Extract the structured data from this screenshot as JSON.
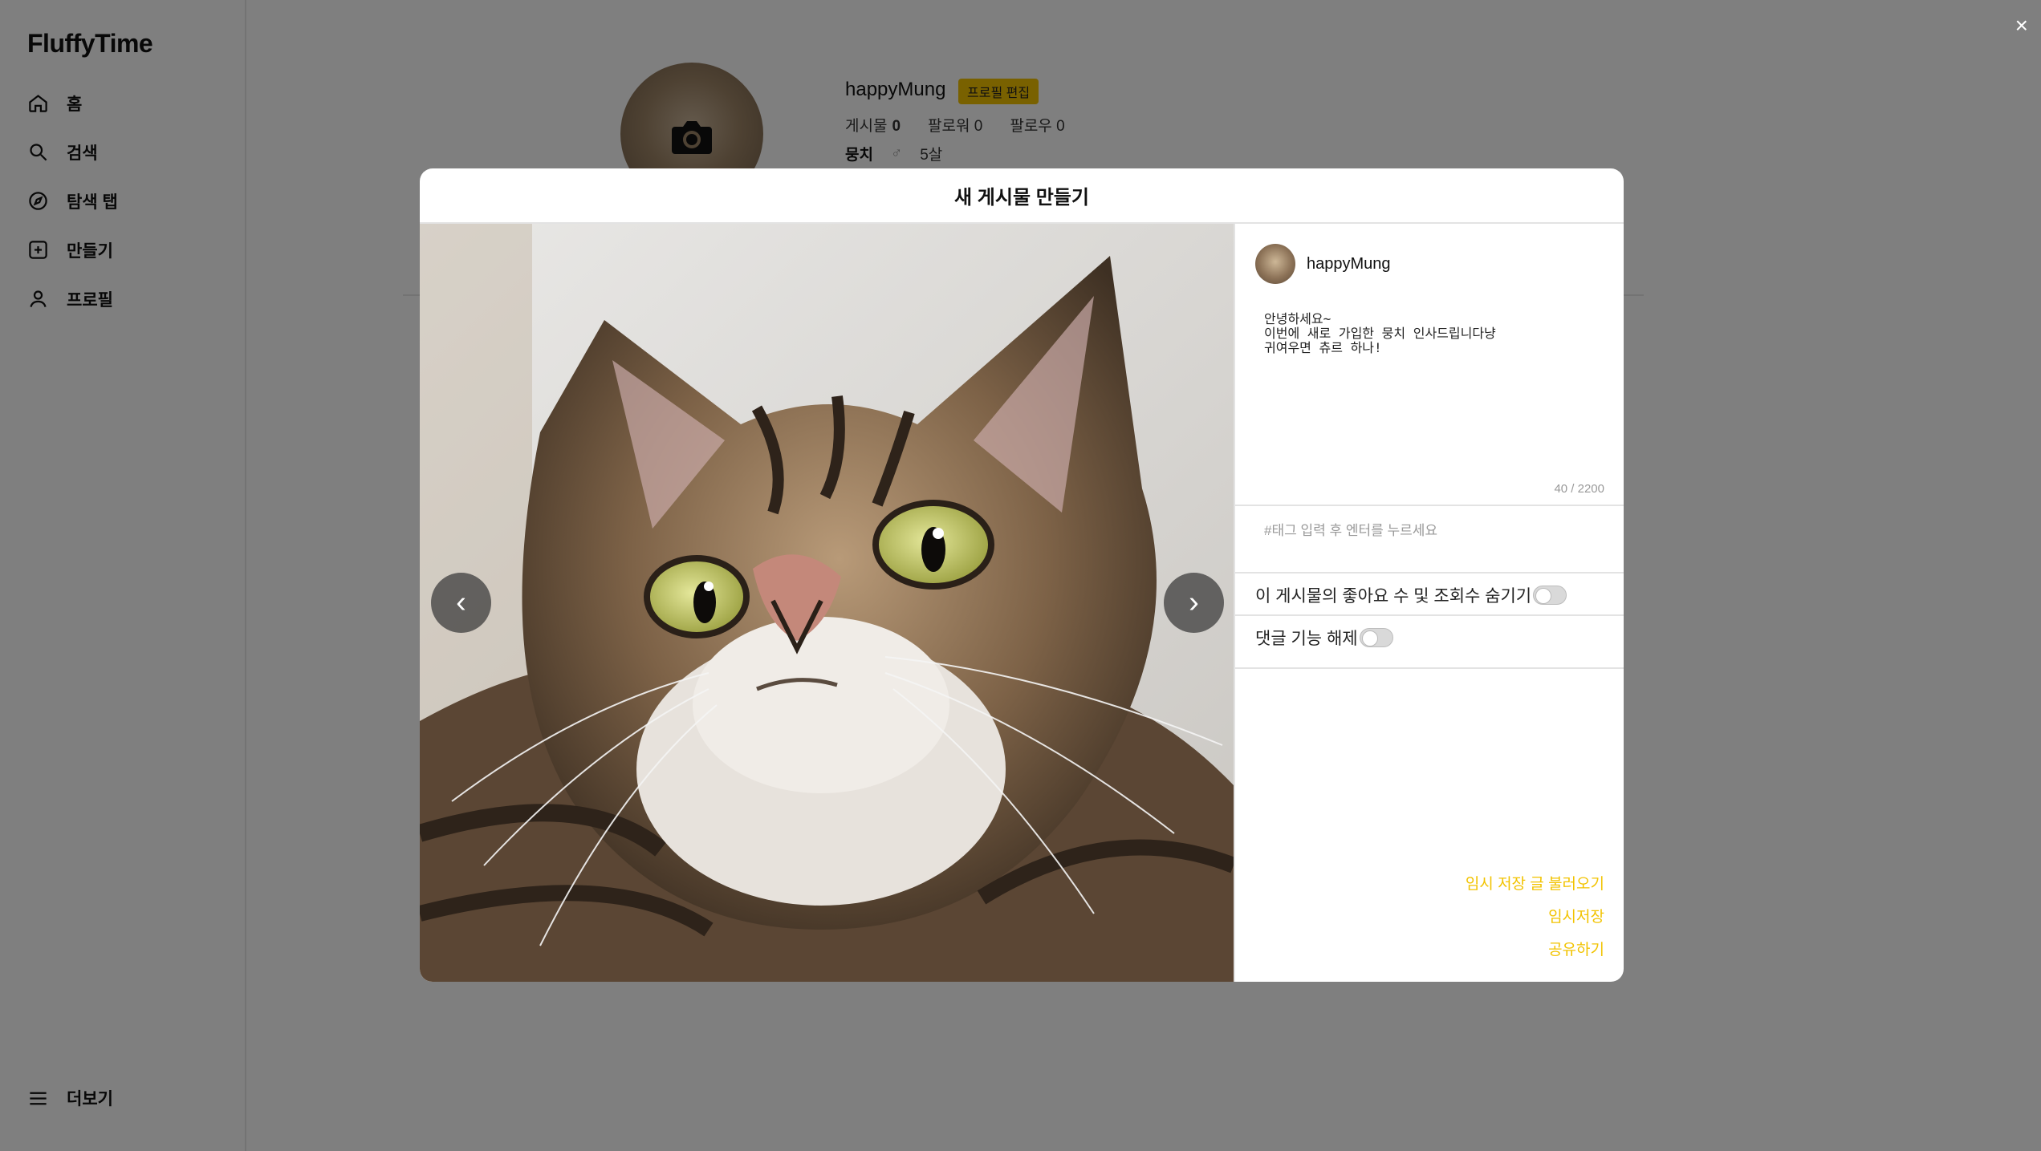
{
  "app": {
    "logo": "FluffyTime"
  },
  "sidebar": {
    "items": [
      {
        "label": "홈",
        "icon": "home-icon"
      },
      {
        "label": "검색",
        "icon": "search-icon"
      },
      {
        "label": "탐색 탭",
        "icon": "compass-icon"
      },
      {
        "label": "만들기",
        "icon": "plus-square-icon"
      },
      {
        "label": "프로필",
        "icon": "user-icon"
      }
    ],
    "more": {
      "label": "더보기",
      "icon": "menu-icon"
    }
  },
  "profile": {
    "username": "happyMung",
    "edit_label": "프로필 편집",
    "posts_label": "게시물",
    "posts_count": "0",
    "followers_label": "팔로워",
    "followers_count": "0",
    "following_label": "팔로우",
    "following_count": "0",
    "pet_name": "뭉치",
    "gender_symbol": "♂",
    "age": "5살"
  },
  "modal": {
    "title": "새 게시물 만들기",
    "prev_label": "‹",
    "next_label": "›",
    "author": "happyMung",
    "caption": "안녕하세요~\n이번에 새로 가입한 뭉치 인사드립니다냥\n귀여우면 츄르 하나!",
    "char_count": "40 / 2200",
    "tag_placeholder": "#태그 입력 후 엔터를 누르세요",
    "hide_likes_label": "이 게시물의 좋아요 수 및 조회수 숨기기",
    "hide_likes_on": false,
    "disable_comments_label": "댓글 기능 해제",
    "disable_comments_on": false,
    "load_draft_label": "임시 저장 글 불러오기",
    "save_draft_label": "임시저장",
    "share_label": "공유하기"
  },
  "colors": {
    "accent": "#f2c300",
    "overlay": "rgba(0,0,0,0.5)"
  },
  "close_label": "×"
}
